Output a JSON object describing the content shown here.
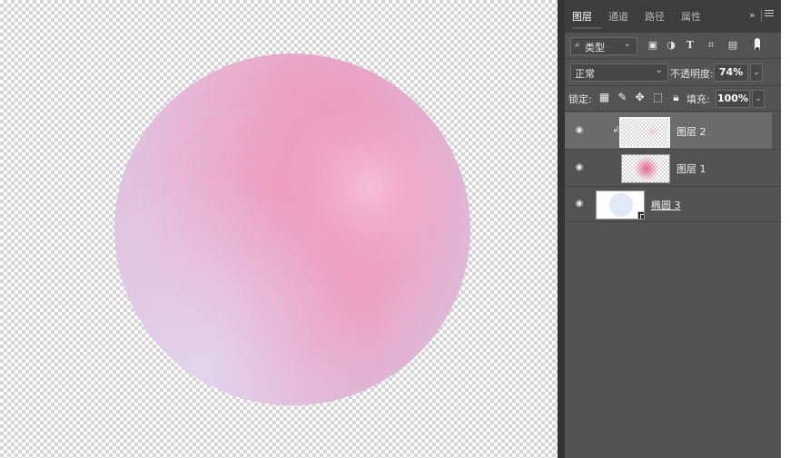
{
  "canvas": {
    "background": "transparent-checkerboard"
  },
  "layers_panel": {
    "tabs": [
      {
        "label": "图层",
        "active": true
      },
      {
        "label": "通道",
        "active": false
      },
      {
        "label": "路径",
        "active": false
      },
      {
        "label": "属性",
        "active": false
      }
    ],
    "collapse_icon": "»",
    "filter": {
      "kind_label": "类型",
      "filter_icons": [
        "image-filter-icon",
        "adjustment-filter-icon",
        "type-filter-icon",
        "shape-filter-icon",
        "smartobject-filter-icon"
      ]
    },
    "blend_mode": "正常",
    "opacity_label": "不透明度:",
    "opacity_value": "74%",
    "lock_label": "锁定:",
    "fill_label": "填充:",
    "fill_value": "100%",
    "layers": [
      {
        "name": "图层 2",
        "selected": true,
        "clipped": true,
        "visible": true
      },
      {
        "name": "图层 1",
        "selected": false,
        "clipped": true,
        "visible": true
      },
      {
        "name": "椭圆 3",
        "selected": false,
        "clipped": false,
        "visible": true,
        "shape_layer": true
      }
    ]
  },
  "colors": {
    "panel_bg": "#535353",
    "panel_tabs_bg": "#3d3d3d",
    "selected_layer": "#6b6b6b",
    "sphere_pink": "#ee9fc1",
    "sphere_lavender": "#ddd3ee"
  }
}
